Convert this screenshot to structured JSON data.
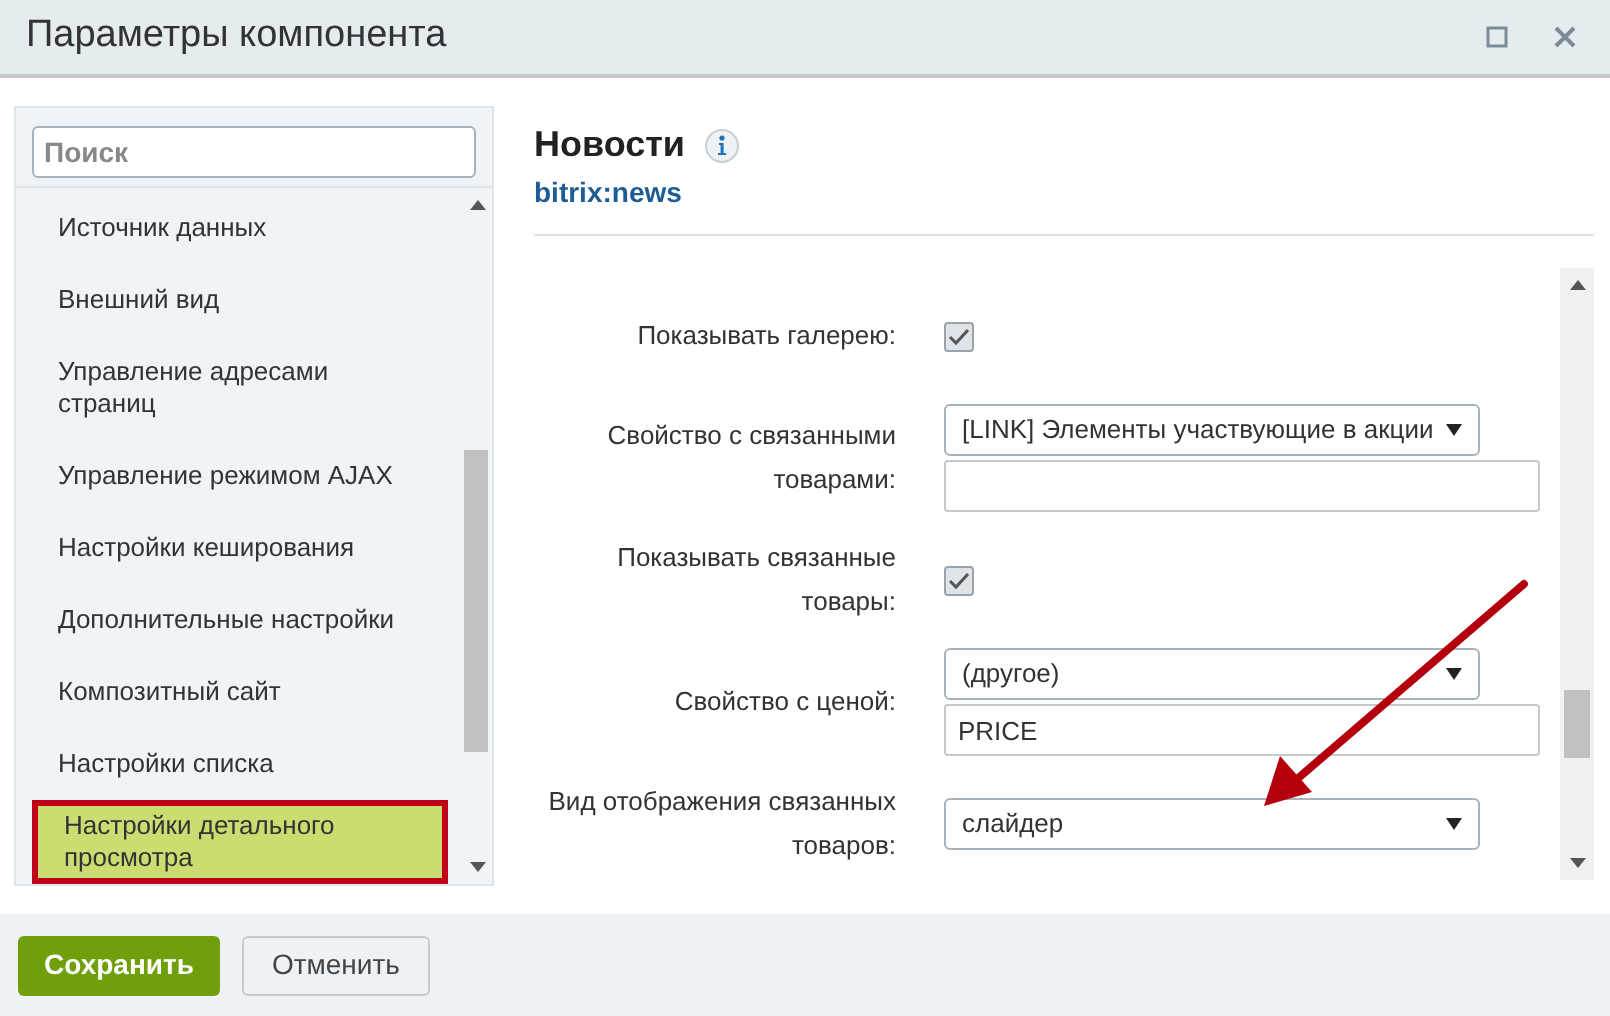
{
  "window": {
    "title": "Параметры компонента"
  },
  "sidebar": {
    "search": {
      "placeholder": "Поиск"
    },
    "items": [
      {
        "label": "Источник данных",
        "selected": false
      },
      {
        "label": "Внешний вид",
        "selected": false
      },
      {
        "label": "Управление адресами страниц",
        "selected": false
      },
      {
        "label": "Управление режимом AJAX",
        "selected": false
      },
      {
        "label": "Настройки кеширования",
        "selected": false
      },
      {
        "label": "Дополнительные настройки",
        "selected": false
      },
      {
        "label": "Композитный сайт",
        "selected": false
      },
      {
        "label": "Настройки списка",
        "selected": false
      },
      {
        "label": "Настройки детального просмотра",
        "selected": true
      }
    ]
  },
  "component": {
    "title": "Новости",
    "code": "bitrix:news"
  },
  "form": [
    {
      "kind": "checkbox",
      "label": "Показывать галерею:",
      "checked": true
    },
    {
      "kind": "select_input",
      "label": "Свойство с связанными товарами:",
      "value": "[LINK] Элементы участвующие в акции"
    },
    {
      "kind": "checkbox",
      "label": "Показывать связанные товары:",
      "checked": true
    },
    {
      "kind": "select_input",
      "label": "Свойство с ценой:",
      "value": "(другое)",
      "input": "PRICE"
    },
    {
      "kind": "select",
      "label": "Вид отображения связанных товаров:",
      "value": "слайдер"
    }
  ],
  "buttons": [
    {
      "label": "Сохранить",
      "kind": "primary"
    },
    {
      "label": "Отменить",
      "kind": "secondary"
    }
  ]
}
